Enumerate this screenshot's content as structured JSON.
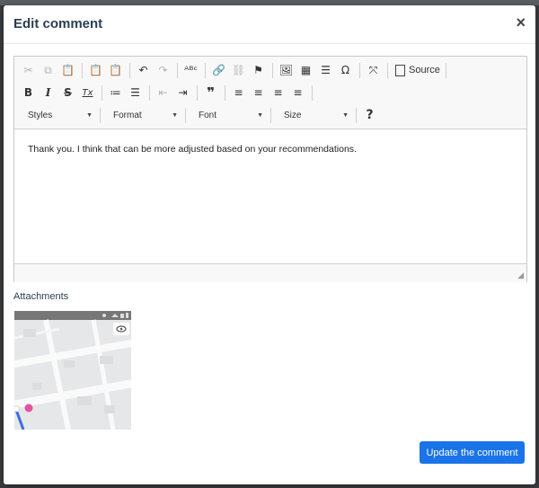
{
  "modal": {
    "title": "Edit comment",
    "close_glyph": "×"
  },
  "toolbar": {
    "row1": [
      {
        "icon": "cut-icon",
        "glyph": "✂",
        "enabled": false
      },
      {
        "icon": "copy-icon",
        "glyph": "⧉",
        "enabled": false
      },
      {
        "icon": "paste-icon",
        "glyph": "📋",
        "enabled": true
      },
      {
        "icon": "paste-text-icon",
        "glyph": "📋",
        "enabled": true
      },
      {
        "icon": "paste-word-icon",
        "glyph": "📋",
        "enabled": true
      },
      {
        "icon": "undo-icon",
        "glyph": "↶",
        "enabled": true
      },
      {
        "icon": "redo-icon",
        "glyph": "↷",
        "enabled": false
      },
      {
        "icon": "spellcheck-icon",
        "glyph": "ᴬᴮᶜ",
        "enabled": true
      },
      {
        "icon": "link-icon",
        "glyph": "🔗",
        "enabled": true
      },
      {
        "icon": "unlink-icon",
        "glyph": "⛓",
        "enabled": false
      },
      {
        "icon": "anchor-icon",
        "glyph": "⚑",
        "enabled": true
      },
      {
        "icon": "image-icon",
        "glyph": "🖼",
        "enabled": true
      },
      {
        "icon": "table-icon",
        "glyph": "▦",
        "enabled": true
      },
      {
        "icon": "horizontal-line-icon",
        "glyph": "☰",
        "enabled": true
      },
      {
        "icon": "special-char-icon",
        "glyph": "Ω",
        "enabled": true
      },
      {
        "icon": "maximize-icon",
        "glyph": "⤧",
        "enabled": true
      }
    ],
    "source_label": "Source",
    "row2": [
      {
        "icon": "bold-icon",
        "glyph": "B",
        "enabled": true
      },
      {
        "icon": "italic-icon",
        "glyph": "I",
        "enabled": true
      },
      {
        "icon": "strikethrough-icon",
        "glyph": "S",
        "enabled": true
      },
      {
        "icon": "remove-format-icon",
        "glyph": "Tx",
        "enabled": true
      },
      {
        "icon": "numbered-list-icon",
        "glyph": "≔",
        "enabled": true
      },
      {
        "icon": "bulleted-list-icon",
        "glyph": "☰",
        "enabled": true
      },
      {
        "icon": "outdent-icon",
        "glyph": "⇤",
        "enabled": false
      },
      {
        "icon": "indent-icon",
        "glyph": "⇥",
        "enabled": true
      },
      {
        "icon": "blockquote-icon",
        "glyph": "❞",
        "enabled": true
      },
      {
        "icon": "align-left-icon",
        "glyph": "≡",
        "enabled": true
      },
      {
        "icon": "align-center-icon",
        "glyph": "≡",
        "enabled": true
      },
      {
        "icon": "align-right-icon",
        "glyph": "≡",
        "enabled": true
      },
      {
        "icon": "justify-icon",
        "glyph": "≡",
        "enabled": true
      }
    ],
    "combos": [
      {
        "name": "styles-dropdown",
        "label": "Styles"
      },
      {
        "name": "format-dropdown",
        "label": "Format"
      },
      {
        "name": "font-dropdown",
        "label": "Font"
      },
      {
        "name": "size-dropdown",
        "label": "Size"
      }
    ],
    "help_glyph": "?"
  },
  "editor": {
    "content": "Thank you. I think that can be more adjusted based on your recommendations."
  },
  "attachments": {
    "label": "Attachments",
    "thumbnail_icon": "map-screenshot"
  },
  "actions": {
    "update_label": "Update the comment"
  },
  "colors": {
    "accent": "#1a73e8",
    "title": "#2c3e50"
  }
}
